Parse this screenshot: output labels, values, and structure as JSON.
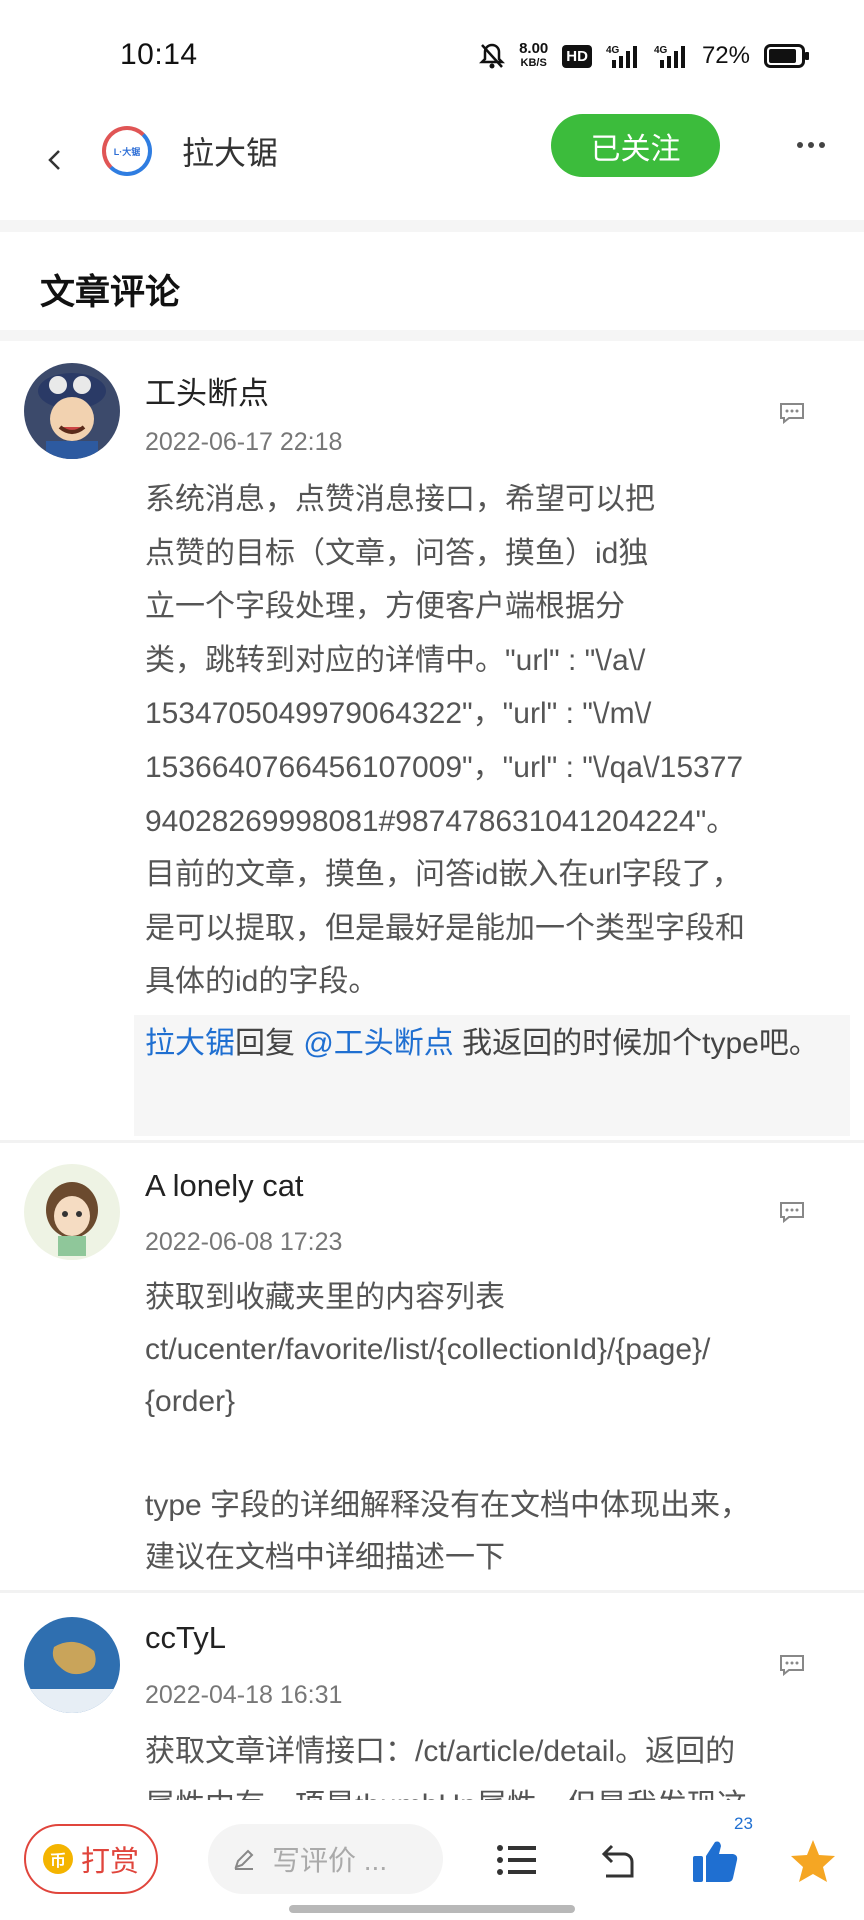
{
  "status_bar": {
    "time": "10:14",
    "net_speed_value": "8.00",
    "net_speed_unit": "KB/S",
    "hd_badge": "HD",
    "signal1_label": "4G",
    "signal2_label": "4G",
    "battery_percent": "72%"
  },
  "header": {
    "logo_text": "L·大锯",
    "title": "拉大锯",
    "follow_label": "已关注"
  },
  "section_title": "文章评论",
  "comments": [
    {
      "name": "工头断点",
      "date": "2022-06-17 22:18",
      "body": "系统消息，点赞消息接口，希望可以把\n点赞的目标（文章，问答，摸鱼）id独\n立一个字段处理，方便客户端根据分\n类，跳转到对应的详情中。\"url\" : \"\\/a\\/\n1534705049979064322\"，\"url\" : \"\\/m\\/\n1536640766456107009\"，\"url\" : \"\\/qa\\/15377\n94028269998081#987478631041204224\"。\n目前的文章，摸鱼，问答id嵌入在url字段了，\n是可以提取，但是最好是能加一个类型字段和\n具体的id的字段。",
      "reply": {
        "from": "拉大锯",
        "verb": "回复 ",
        "to": "@工头断点",
        "text": " 我返回的时候加个type吧。"
      }
    },
    {
      "name": "A lonely cat",
      "date": "2022-06-08 17:23",
      "body": "获取到收藏夹里的内容列表\nct/ucenter/favorite/list/{collectionId}/{page}/\n{order}\n\ntype 字段的详细解释没有在文档中体现出来，\n建议在文档中详细描述一下"
    },
    {
      "name": "ccTyL",
      "date": "2022-04-18 16:31",
      "body": "获取文章详情接口：/ct/article/detail。返回的\n属性中有一项是thumbUp属性，但是我发现这"
    }
  ],
  "bottom_bar": {
    "coin_glyph": "币",
    "tip_label": "打赏",
    "write_placeholder": "写评价 ...",
    "like_count": "23"
  },
  "colors": {
    "follow_green": "#3cbc3c",
    "link_blue": "#1f6fd1",
    "tip_red": "#e0453c",
    "star_orange": "#f5a623"
  }
}
